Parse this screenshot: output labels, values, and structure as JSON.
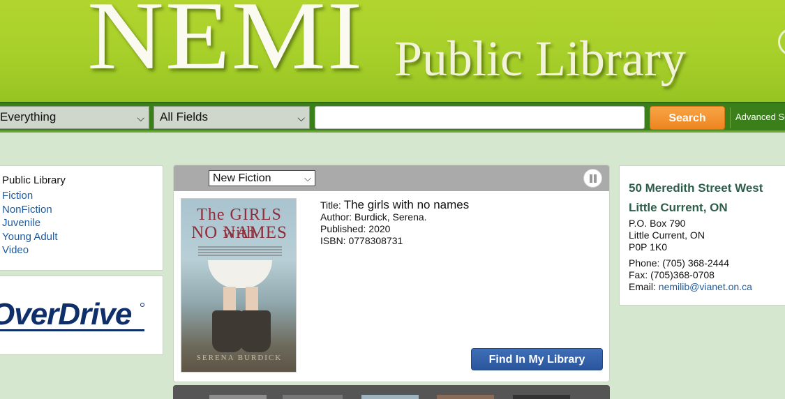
{
  "header": {
    "logo_main": "NEMI",
    "logo_sub": "Public Library"
  },
  "searchbar": {
    "scope_selected": "Everything",
    "field_selected": "All Fields",
    "query_value": "",
    "search_label": "Search",
    "advanced_label": "Advanced Se"
  },
  "left": {
    "heading": "Public Library",
    "links": [
      "Fiction",
      "NonFiction",
      "Juvenile",
      "Young Adult",
      "Video"
    ],
    "overdrive_logo": "OverDrive"
  },
  "carousel": {
    "list_selected": "New Fiction",
    "cover": {
      "title_line1": "The GIRLS with",
      "title_line2": "NO NAMES",
      "author": "SERENA BURDICK"
    },
    "book": {
      "title_label": "Title:",
      "title": "The girls with no names",
      "author_label": "Author:",
      "author": "Burdick, Serena.",
      "published_label": "Published:",
      "published": "2020",
      "isbn_label": "ISBN:",
      "isbn": "0778308731"
    },
    "find_label": "Find In My Library"
  },
  "contact": {
    "street": "50 Meredith Street West",
    "city": "Little Current, ON",
    "po_box": "P.O. Box 790",
    "town": "Little Current, ON",
    "postal": "P0P 1K0",
    "phone_label": "Phone:",
    "phone": "(705) 368-2444",
    "fax_label": "Fax:",
    "fax": "(705)368-0708",
    "email_label": "Email:",
    "email": "nemilib@vianet.on.ca"
  },
  "colors": {
    "banner": "#a7cf2a",
    "searchbar": "#3a7f1a",
    "search_button": "#ee8520",
    "find_button": "#2a559c",
    "page_bg": "#d6e7cf",
    "link": "#1e5a9c"
  }
}
